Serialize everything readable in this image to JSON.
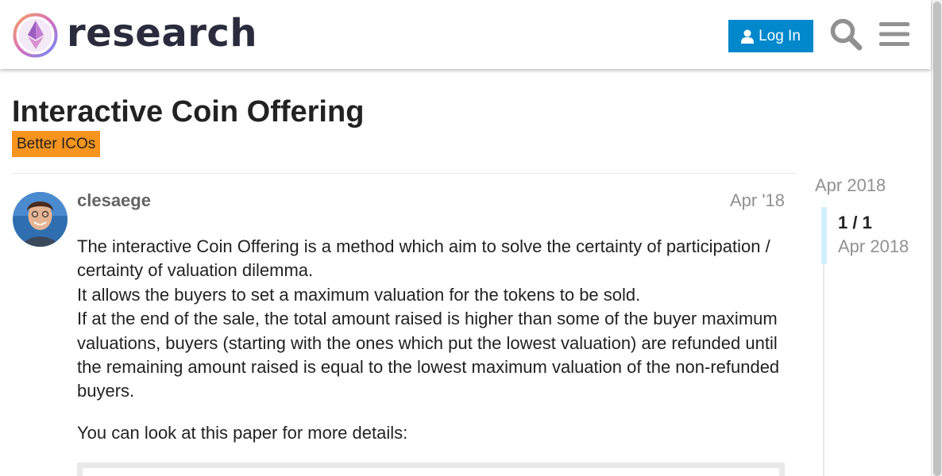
{
  "header": {
    "brand": "research",
    "login_label": "Log In"
  },
  "topic": {
    "title": "Interactive Coin Offering",
    "category": "Better ICOs",
    "category_color": "#f7941d"
  },
  "post": {
    "username": "clesaege",
    "date": "Apr '18",
    "paragraph1_line1": "The interactive Coin Offering is a method which aim to solve the certainty of participation / certainty of valuation dilemma.",
    "paragraph1_line2": "It allows the buyers to set a maximum valuation for the tokens to be sold.",
    "paragraph1_line3": "If at the end of the sale, the total amount raised is higher than some of the buyer maximum valuations, buyers (starting with the ones which put the lowest valuation) are refunded until the remaining amount raised is equal to the lowest maximum valuation of the non-refunded buyers.",
    "paragraph2": "You can look at this paper for more details:"
  },
  "timeline": {
    "start_date": "Apr 2018",
    "progress": "1 / 1",
    "current_date": "Apr 2018"
  },
  "colors": {
    "accent": "#0088cc",
    "brand_text": "#2a2b3d",
    "muted": "#919191"
  },
  "icons": {
    "logo": "ethresearch-logo",
    "user": "user-icon",
    "search": "search-icon",
    "menu": "hamburger-menu-icon"
  }
}
